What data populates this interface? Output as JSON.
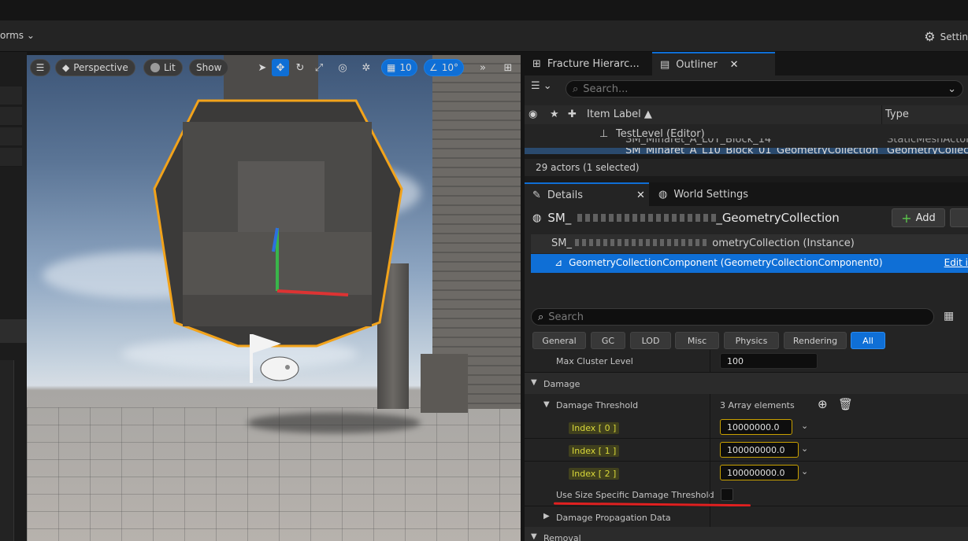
{
  "toolbar": {
    "left_label": "orms",
    "right_label": "Settin"
  },
  "viewport": {
    "perspective": "Perspective",
    "lit": "Lit",
    "show": "Show",
    "grid_value": "10",
    "angle_value": "10°"
  },
  "outliner": {
    "tab_fracture": "Fracture Hierarc...",
    "tab_outliner": "Outliner",
    "search_placeholder": "Search...",
    "col_label": "Item Label ▲",
    "col_type": "Type",
    "level": "TestLevel (Editor)",
    "item1_label": "SM_Minaret_A_L0T_Block_14",
    "item1_type": "StaticMeshActor",
    "item2_label": "SM_Minaret_A_L10_Block_01_GeometryCollection",
    "item2_type": "GeometryCollectio",
    "status": "29 actors (1 selected)"
  },
  "details": {
    "tab_details": "Details",
    "tab_world": "World Settings",
    "actor_name_start": "SM_",
    "actor_name_end": "_GeometryCollection",
    "add_label": "Add",
    "instance_start": "SM_",
    "instance_end": "ometryCollection (Instance)",
    "component": "GeometryCollectionComponent (GeometryCollectionComponent0)",
    "edit_link": "Edit i",
    "search_placeholder": "Search",
    "filters": [
      "General",
      "GC",
      "LOD",
      "Misc",
      "Physics",
      "Rendering",
      "All"
    ],
    "max_cluster_label": "Max Cluster Level",
    "max_cluster_value": "100",
    "damage_section": "Damage",
    "damage_threshold_label": "Damage Threshold",
    "damage_threshold_count": "3 Array elements",
    "index0_label": "Index [ 0 ]",
    "index0_value": "10000000.0",
    "index1_label": "Index [ 1 ]",
    "index1_value": "100000000.0",
    "index2_label": "Index [ 2 ]",
    "index2_value": "100000000.0",
    "size_specific_label": "Use Size Specific Damage Threshold",
    "propagation_label": "Damage Propagation Data",
    "removal_section": "Removal"
  },
  "colors": {
    "accent": "#0f6fd6",
    "underline": "#e02020",
    "selection": "#f2a31b"
  }
}
